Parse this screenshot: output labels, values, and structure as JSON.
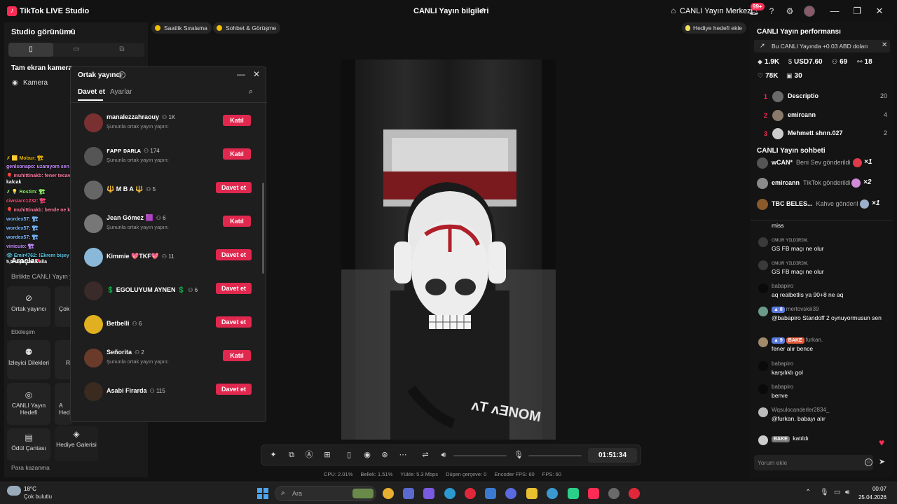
{
  "titlebar": {
    "app_name": "TikTok LIVE Studio",
    "center_title": "CANLI Yayın bilgileri",
    "center_right": "CANLI Yayın Merkezi",
    "notification_badge": "99+"
  },
  "left": {
    "studio_title": "Studio görünümü",
    "tam_ekran": "Tam ekran kamera",
    "kamera": "Kamera",
    "araclar": "Araçlar",
    "birlikte": "Birlikte CANLI Yayın y",
    "tools": [
      {
        "label": "Ortak yayıncı",
        "icon": "link-icon"
      },
      {
        "label": "Çok",
        "icon": "grid-icon"
      },
      {
        "label": "İzleyici Dilekleri",
        "icon": "people-icon"
      },
      {
        "label": "R",
        "icon": "gift-icon"
      },
      {
        "label": "CANLI Yayın Hedefi",
        "icon": "target-icon"
      },
      {
        "label": "A Hed",
        "icon": "flag-icon"
      },
      {
        "label": "Ödül Çantası",
        "icon": "bag-icon"
      },
      {
        "label": "Hediye Galerisi",
        "icon": "gallery-icon"
      }
    ],
    "etkilesim": "Etkileşim",
    "para": "Para kazanma"
  },
  "overlay_chat": [
    {
      "text": "✗ 🟨 Mobur: 🏗",
      "color": "#e6b400"
    },
    {
      "text": "genlsonapo: uzanıyom sen",
      "color": "#c58cff"
    },
    {
      "text": "🎈 muhittinakb: fener tecavüz edicek , prezervatif getirin lazım",
      "color": "#ff7aa0"
    },
    {
      "text": "kalcak",
      "color": "#ffffff"
    },
    {
      "text": "✗ 💡 Rostim: 🏗",
      "color": "#8ef06a"
    },
    {
      "text": "ciwsiarc1232: 🏗",
      "color": "#ff4d7a"
    },
    {
      "text": "🎈 muhittinakb: bende ne kadar ortak yapcumüz var",
      "color": "#ff7aa0"
    },
    {
      "text": "wordex57: 🏗",
      "color": "#7ab8ff"
    },
    {
      "text": "wordex57: 🏗",
      "color": "#7ab8ff"
    },
    {
      "text": "wordex57: 🏗",
      "color": "#7ab8ff"
    },
    {
      "text": "vinicuio: 🏗",
      "color": "#c58cff"
    },
    {
      "text": "👁 Emir4762: !Ekrem bişey mi fena sarar ne para kırarsın saat",
      "color": "#5cc8e8"
    },
    {
      "text": "5,te açarsan valla",
      "color": "#ffffff"
    }
  ],
  "popup": {
    "title": "Ortak yayıncı",
    "tab_invite": "Davet et",
    "tab_settings": "Ayarlar",
    "rows": [
      {
        "name": "manalezzahraouy",
        "count": "1K",
        "sub": "Şununla ortak yayın yapın:",
        "btn": "Katıl",
        "avatar": "#7a3030"
      },
      {
        "name": "ꜰᴀᴘᴘ ᴅᴀʀʟᴀ",
        "count": "174",
        "sub": "Şununla ortak yayın yapın:",
        "btn": "Katıl",
        "avatar": "#555555"
      },
      {
        "name": "🔱 M B A 🔱",
        "count": "5",
        "sub": "",
        "btn": "Davet et",
        "avatar": "#666666"
      },
      {
        "name": "Jean Gómez 🟪",
        "count": "6",
        "sub": "Şununla ortak yayın yapın:",
        "btn": "Katıl",
        "avatar": "#777777"
      },
      {
        "name": "Kimmie 💖TKF💖",
        "count": "11",
        "sub": "",
        "btn": "Davet et",
        "avatar": "#8ab8d8"
      },
      {
        "name": "💲 EGOLUYUM AYNEN 💲",
        "count": "6",
        "sub": "",
        "btn": "Davet et",
        "avatar": "#3a2a2a"
      },
      {
        "name": "Betbelli",
        "count": "6",
        "sub": "",
        "btn": "Davet et",
        "avatar": "#e0b020"
      },
      {
        "name": "Señorita",
        "count": "2",
        "sub": "Şununla ortak yayın yapın:",
        "btn": "Katıl",
        "avatar": "#6a3a2a"
      },
      {
        "name": "Asabi Firarda",
        "count": "115",
        "sub": "",
        "btn": "Davet et",
        "avatar": "#3a2a20"
      }
    ]
  },
  "chips": {
    "saatlik": "Saatlik Sıralama",
    "sohbet": "Sohbet & Görüşme",
    "hediye": "Hediye hedefi ekle"
  },
  "controls": {
    "time": "01:51:34"
  },
  "stats": {
    "cpu": "CPU: 2.01%",
    "bellek": "Bellek: 1.51%",
    "yukle": "Yükle: 5.3 Mbps",
    "dusen": "Düşen çerçeve: 0",
    "encoder": "Encoder FPS: 60",
    "fps": "FPS: 60"
  },
  "right": {
    "title": "CANLI Yayın performansı",
    "banner": "Bu CANLI Yayında +0.03 ABD doları",
    "stats": [
      {
        "icon": "diamond-icon",
        "value": "1.9K"
      },
      {
        "icon": "dollar-icon",
        "value": "USD7.60"
      },
      {
        "icon": "viewers-icon",
        "value": "69"
      },
      {
        "icon": "followers-icon",
        "value": "18"
      },
      {
        "icon": "heart-icon",
        "value": "78K"
      },
      {
        "icon": "gift-icon",
        "value": "30"
      }
    ],
    "ranking": [
      {
        "rank": "1",
        "name": "Descriptio",
        "value": "20"
      },
      {
        "rank": "2",
        "name": "emircann",
        "value": "4"
      },
      {
        "rank": "3",
        "name": "Mehmett shnn.027",
        "value": "2"
      }
    ],
    "chat_title": "CANLI Yayın sohbeti",
    "gifts": [
      {
        "name": "wCAN*",
        "action": "Beni Sev gönderildi",
        "count": "×1",
        "color": "#e03a4a"
      },
      {
        "name": "emircann",
        "action": "TikTok gönderildi",
        "count": "×2",
        "color": "#d08ad8"
      },
      {
        "name": "TBC BELES...",
        "action": "Kahve gönderil",
        "count": "×1",
        "color": "#9ab0c8"
      }
    ],
    "messages": [
      {
        "user": "",
        "text": "miss"
      },
      {
        "user": "ᴄᴍᴜʀ ʏɪʟᴅɪʀɪᴍ.",
        "text": "GS FB maçı ne olur"
      },
      {
        "user": "ᴄᴍᴜʀ ʏɪʟᴅɪʀɪᴍ.",
        "text": "GS FB maçı ne olur"
      },
      {
        "user": "babapiro",
        "text": "aq realbetlis ya 90+8 ne aq"
      },
      {
        "user": "8 mertovskiii39",
        "text": "@babapiro Standoff 2 oynuyormusun sen"
      },
      {
        "user": "9 BAKE furkan.",
        "text": "fener alır bence"
      },
      {
        "user": "babapiro",
        "text": "karşılıklı gol"
      },
      {
        "user": "babapiro",
        "text": "benve"
      },
      {
        "user": "Wqsulocanderler2834_",
        "text": "@furkan. babayı alır"
      },
      {
        "user": "BAKE",
        "text": "katıldı"
      }
    ],
    "input_placeholder": "Yorum ekle"
  },
  "taskbar": {
    "temp": "18°C",
    "weather": "Çok bulutlu",
    "search_placeholder": "Ara",
    "time": "00:07",
    "date": "25.04.2026"
  }
}
